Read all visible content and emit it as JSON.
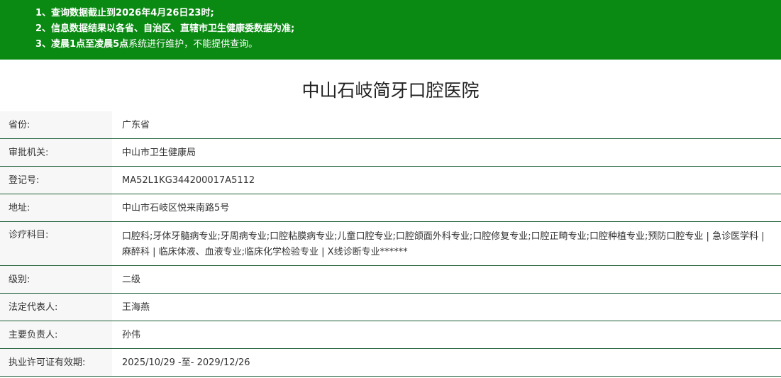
{
  "notice": {
    "lines": [
      {
        "prefix": "1、查询数据截止到2026年4月26日23时;",
        "bold": "",
        "suffix": ""
      },
      {
        "prefix": "2、信息数据结果以各省、自治区、直辖市卫生健康委数据为准;",
        "bold": "",
        "suffix": ""
      },
      {
        "prefix": "3、凌晨1点至凌晨5点",
        "bold": "",
        "suffix": "系统进行维护，不能提供查询。"
      }
    ],
    "background_color": "#0b8a13"
  },
  "hospital": {
    "name": "中山石岐简牙口腔医院"
  },
  "fields": [
    {
      "label": "省份:",
      "value": "广东省"
    },
    {
      "label": "审批机关:",
      "value": "中山市卫生健康局"
    },
    {
      "label": "登记号:",
      "value": "MA52L1KG344200017A5112"
    },
    {
      "label": "地址:",
      "value": "中山市石岐区悦来南路5号"
    },
    {
      "label": "诊疗科目:",
      "value": "口腔科;牙体牙髓病专业;牙周病专业;口腔粘膜病专业;儿童口腔专业;口腔颌面外科专业;口腔修复专业;口腔正畸专业;口腔种植专业;预防口腔专业 | 急诊医学科 | 麻醉科 | 临床体液、血液专业;临床化学检验专业 | X线诊断专业******"
    },
    {
      "label": "级别:",
      "value": "二级"
    },
    {
      "label": "法定代表人:",
      "value": "王海燕"
    },
    {
      "label": "主要负责人:",
      "value": "孙伟"
    },
    {
      "label": "执业许可证有效期:",
      "value": "2025/10/29 -至- 2029/12/26"
    }
  ],
  "colors": {
    "row_divider": "#1f5f3a",
    "label_background": "#f7f7f7"
  }
}
